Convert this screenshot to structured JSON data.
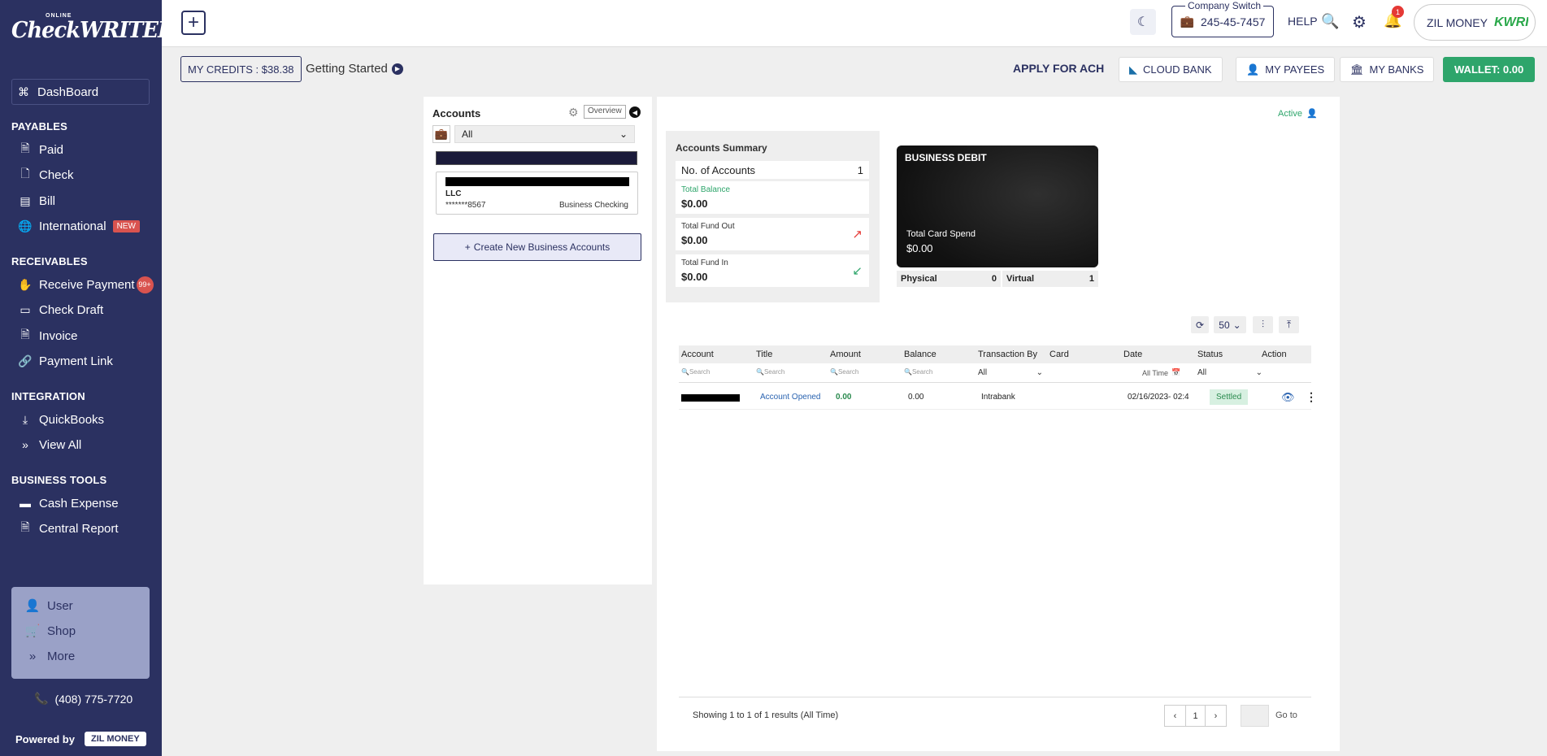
{
  "sidebar": {
    "logo_online": "ONLINE",
    "logo_brand": "CheckWRITER",
    "dashboard": "DashBoard",
    "sections": {
      "payables": "PAYABLES",
      "receivables": "RECEIVABLES",
      "integration": "INTEGRATION",
      "business_tools": "BUSINESS TOOLS"
    },
    "items": {
      "paid": "Paid",
      "check": "Check",
      "bill": "Bill",
      "international": "International",
      "international_badge": "NEW",
      "receive_payment": "Receive Payment",
      "receive_badge": "99+",
      "check_draft": "Check Draft",
      "invoice": "Invoice",
      "payment_link": "Payment Link",
      "quickbooks": "QuickBooks",
      "view_all": "View All",
      "cash_expense": "Cash Expense",
      "central_report": "Central Report"
    },
    "box": {
      "user": "User",
      "shop": "Shop",
      "more": "More"
    },
    "phone": "(408) 775-7720",
    "powered_by": "Powered by",
    "zil_money": "ZIL MONEY"
  },
  "topbar": {
    "company_switch_label": "Company Switch",
    "company_id": "245-45-7457",
    "help": "HELP",
    "notification_count": "1",
    "zil_money": "ZIL MONEY",
    "zil_logo": "KWRITER"
  },
  "actionbar": {
    "credits": "MY CREDITS : $38.38",
    "getting_started": "Getting Started",
    "apply_ach": "APPLY FOR ACH",
    "cloud_bank": "CLOUD BANK",
    "my_payees": "MY PAYEES",
    "my_banks": "MY BANKS",
    "wallet": "WALLET: 0.00"
  },
  "accounts": {
    "title": "Accounts",
    "overview": "Overview",
    "filter_value": "All",
    "card_name": "LLC",
    "card_number": "*******8567",
    "card_type": "Business Checking",
    "create_button": "Create New Business Accounts"
  },
  "main": {
    "status": "Active",
    "summary": {
      "title": "Accounts Summary",
      "no_accounts_label": "No. of Accounts",
      "no_accounts_value": "1",
      "total_balance_label": "Total Balance",
      "total_balance_value": "$0.00",
      "total_fund_out_label": "Total Fund Out",
      "total_fund_out_value": "$0.00",
      "total_fund_in_label": "Total Fund In",
      "total_fund_in_value": "$0.00"
    },
    "card": {
      "title": "BUSINESS DEBIT",
      "spend_label": "Total Card Spend",
      "spend_value": "$0.00",
      "physical_label": "Physical",
      "physical_value": "0",
      "virtual_label": "Virtual",
      "virtual_value": "1"
    },
    "page_size": "50",
    "table": {
      "columns": [
        "Account",
        "Title",
        "Amount",
        "Balance",
        "Transaction By",
        "Card",
        "Date",
        "Status",
        "Action"
      ],
      "search_placeholder": "Search",
      "filter_all": "All",
      "date_filter": "All Time",
      "row": {
        "title": "Account Opened",
        "amount": "0.00",
        "balance": "0.00",
        "transaction_by": "Intrabank",
        "date": "02/16/2023- 02:4",
        "status": "Settled"
      }
    },
    "footer": {
      "showing": "Showing 1 to 1 of 1 results (All Time)",
      "page": "1",
      "goto": "Go to"
    }
  },
  "colors": {
    "sidebar_bg": "#2b3161",
    "accent_green": "#2ea56b",
    "badge_red": "#d9534f"
  }
}
